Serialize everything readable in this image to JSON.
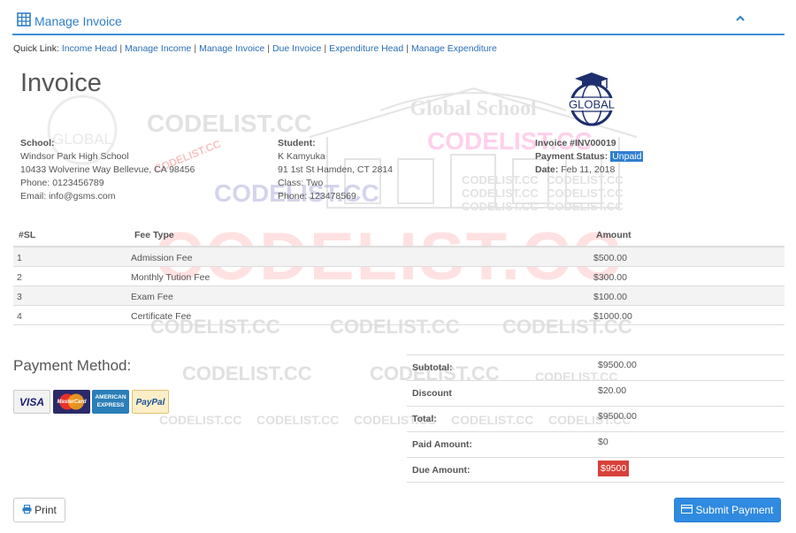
{
  "header": {
    "title": "Manage Invoice",
    "collapse_icon": "chevron-up-icon",
    "table_icon": "table-icon"
  },
  "quick_links": {
    "label": "Quick Link:",
    "links": [
      "Income Head",
      "Manage Income",
      "Manage Invoice",
      "Due Invoice",
      "Expenditure Head",
      "Manage Expenditure"
    ]
  },
  "watermark": {
    "text": "CODELIST.CC",
    "school_banner": "Global School",
    "logo_text": "GLOBAL"
  },
  "invoice": {
    "title": "Invoice",
    "logo_text": "GLOBAL",
    "school": {
      "label": "School:",
      "name": "Windsor Park High School",
      "address": "10433 Wolverine Way Bellevue, CA 98456",
      "phone": "Phone: 0123456789",
      "email": "Email: info@gsms.com"
    },
    "student": {
      "label": "Student:",
      "name": "K Kamyuka",
      "address": "91 1st St Hamden, CT 2814",
      "class": "Class: Two",
      "phone": "Phone: 123478569"
    },
    "meta": {
      "number": "Invoice #INV00019",
      "status_label": "Payment Status:",
      "status_value": "Unpaid",
      "date_label": "Date:",
      "date_value": "Feb 11, 2018"
    }
  },
  "fee_table": {
    "headers": [
      "#SL",
      "Fee Type",
      "Amount"
    ],
    "rows": [
      [
        "1",
        "Admission Fee",
        "$500.00"
      ],
      [
        "2",
        "Monthly Tution Fee",
        "$300.00"
      ],
      [
        "3",
        "Exam Fee",
        "$100.00"
      ],
      [
        "4",
        "Certificate Fee",
        "$1000.00"
      ]
    ]
  },
  "payment": {
    "title": "Payment Method:",
    "cards": [
      "VISA",
      "MasterCard",
      "AMERICAN EXPRESS",
      "PayPal"
    ]
  },
  "totals": [
    {
      "label": "Subtotal:",
      "value": "$9500.00"
    },
    {
      "label": "Discount",
      "value": "$20.00"
    },
    {
      "label": "Total:",
      "value": "$9500.00"
    },
    {
      "label": "Paid Amount:",
      "value": "$0"
    },
    {
      "label": "Due Amount:",
      "value": "$9500"
    }
  ],
  "buttons": {
    "print": "Print",
    "submit": "Submit Payment"
  },
  "colors": {
    "accent": "#2f7fc8",
    "due_badge": "#d9403a",
    "status_highlight": "#2f7fd0"
  }
}
